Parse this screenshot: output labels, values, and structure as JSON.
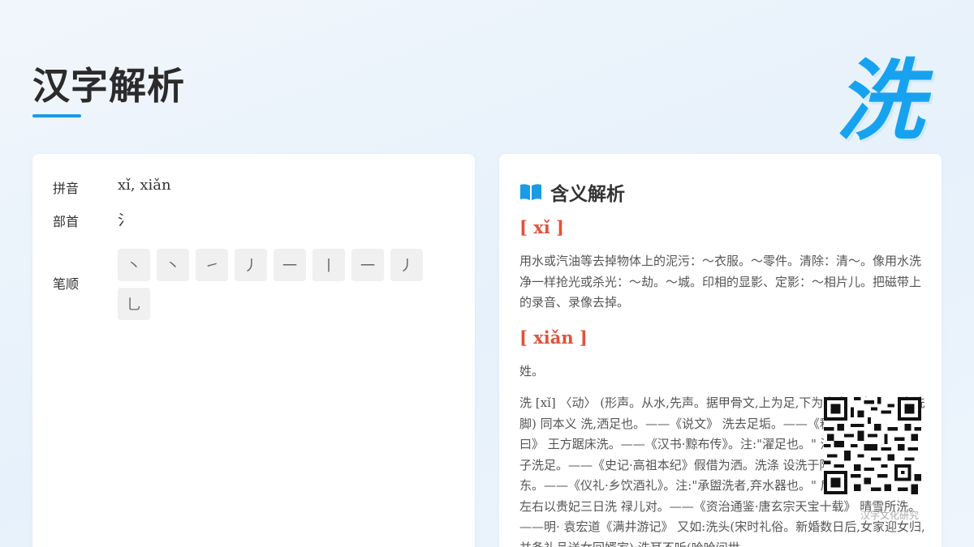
{
  "header": {
    "title": "汉字解析",
    "character": "洗"
  },
  "info": {
    "pinyin_label": "拼音",
    "pinyin_value": "xǐ, xiǎn",
    "radical_label": "部首",
    "radical_value": "氵",
    "strokes_label": "笔顺",
    "strokes": [
      "丶",
      "丶",
      "㇀",
      "丿",
      "一",
      "丨",
      "一",
      "丿",
      "乚"
    ]
  },
  "meaning": {
    "title": "含义解析",
    "icon": "book-icon",
    "sections": [
      {
        "pinyin": "[ xǐ ]",
        "text": "用水或汽油等去掉物体上的泥污：～衣服。～零件。清除：清～。像用水洗净一样抢光或杀光：～劫。～城。印相的显影、定影：～相片儿。把磁带上的录音、录像去掉。"
      },
      {
        "pinyin": "[ xiǎn ]",
        "text": "姓。"
      }
    ],
    "detail": "洗 [xǐ] 〈动〉 (形声。从水,先声。据甲骨文,上为足,下为水盘。本义:用水洗脚) 同本义 洗,洒足也。——《说文》 洗去足垢。——《释名·释言语》 讯曰》 王方踞床洗。——《汉书·黥布传》。注:\"濯足也。\" 沛公方踞床,使两女子洗足。——《史记·高祖本纪》假借为洒。洗涤 设洗于阼阶东南,水在洗东。——《仪礼·乡饮酒礼》。注:\"承盥洗者,弃水器也。\" 后宫欢笑,问其故,左右以贵妃三日洗 禄儿对。——《资治通鉴·唐玄宗天宝十载》 晴雪所洗。——明· 袁宏道《满井游记》 又如:洗头(宋时礼俗。新婚数日后,女家迎女归,并备礼品送女回婿家);洗耳不听(哈哈问世"
  },
  "watermark": "汉字文化研究",
  "colors": {
    "accent": "#1a9be6",
    "char": "#17a2f0",
    "pinyin": "#e0533a"
  }
}
